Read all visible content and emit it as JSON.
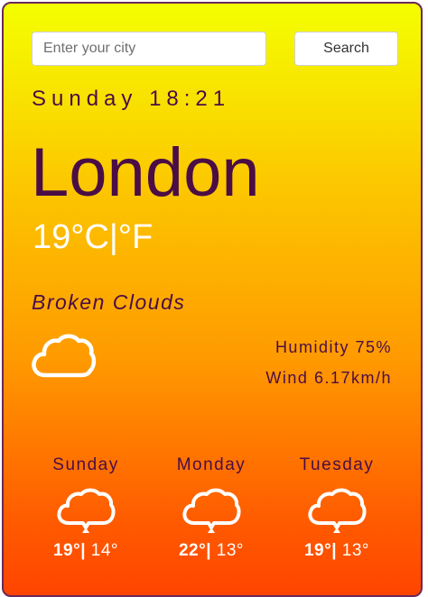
{
  "search": {
    "placeholder": "Enter your city",
    "value": "",
    "button_label": "Search"
  },
  "current": {
    "datetime": "Sunday 18:21",
    "city": "London",
    "temperature": "19",
    "unit_celsius": "°C",
    "unit_separator": "|",
    "unit_fahrenheit": "°F",
    "description": "Broken Clouds",
    "icon": "cloud-icon",
    "humidity_label": "Humidity",
    "humidity_value": "75%",
    "wind_label": "Wind",
    "wind_value": "6.17km/h"
  },
  "forecast": [
    {
      "day": "Sunday",
      "icon": "cloud-icon",
      "max": "19°",
      "sep": "|",
      "min": " 14°"
    },
    {
      "day": "Monday",
      "icon": "cloud-icon",
      "max": "22°",
      "sep": "|",
      "min": " 13°"
    },
    {
      "day": "Tuesday",
      "icon": "cloud-icon",
      "max": "19°",
      "sep": "|",
      "min": " 13°"
    }
  ],
  "colors": {
    "gradient_top": "#f4ff00",
    "gradient_bottom": "#ff4400",
    "text_dark": "#4a0d45",
    "text_light": "#ffffff",
    "border": "#6a2a57"
  }
}
